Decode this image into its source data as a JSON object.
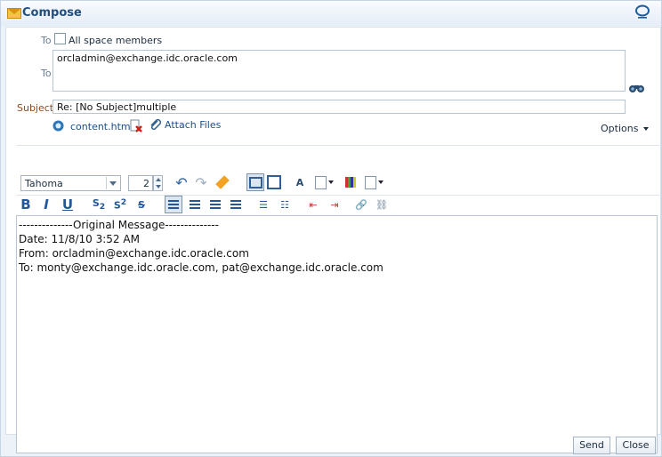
{
  "window": {
    "title": "Compose"
  },
  "form": {
    "to_label": "To",
    "all_space_members": "All space members",
    "recipients_label": "To",
    "recipients": "orcladmin@exchange.idc.oracle.com",
    "subject_label": "Subject",
    "subject": "Re: [No Subject]multiple",
    "attachment_name": "content.html",
    "attach_files": "Attach Files",
    "options": "Options"
  },
  "toolbar": {
    "font": "Tahoma",
    "font_size": "2"
  },
  "message": {
    "lines": [
      "--------------Original Message--------------",
      "Date: 11/8/10 3:52 AM",
      "From: orcladmin@exchange.idc.oracle.com",
      "To: monty@exchange.idc.oracle.com, pat@exchange.idc.oracle.com"
    ]
  },
  "buttons": {
    "send": "Send",
    "close": "Close"
  },
  "icons": {
    "title": "envelope-icon",
    "brand": "oracle-icon",
    "binoculars": "binoculars-icon",
    "attachment": "paperclip-icon",
    "document": "document-icon",
    "delete": "delete-attachment-icon",
    "options_caret": "chevron-down-icon"
  }
}
